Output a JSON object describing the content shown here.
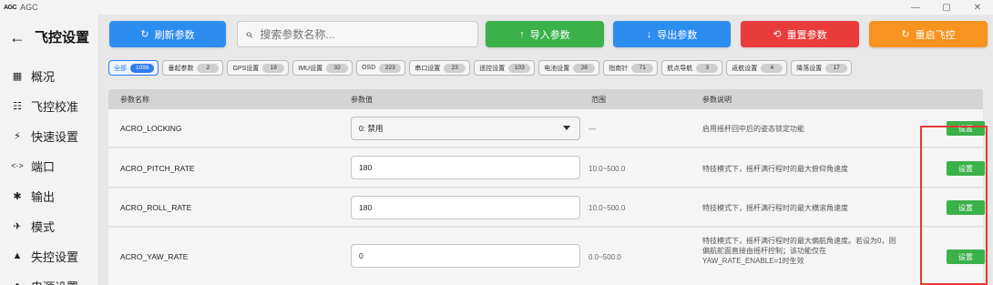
{
  "window": {
    "logo": "AGC",
    "title": "AGC",
    "controls": {
      "minimize": "—",
      "maximize": "▢",
      "close": "✕"
    }
  },
  "sidebar": {
    "back_icon": "←",
    "title": "飞控设置",
    "items": [
      {
        "icon": "grid-icon",
        "glyph": "▦",
        "label": "概况"
      },
      {
        "icon": "sliders-icon",
        "glyph": "☷",
        "label": "飞控校准"
      },
      {
        "icon": "lightning-icon",
        "glyph": "⚡",
        "label": "快速设置"
      },
      {
        "icon": "ports-icon",
        "glyph": "<·>",
        "label": "端口"
      },
      {
        "icon": "gear-icon",
        "glyph": "✱",
        "label": "输出"
      },
      {
        "icon": "airplane-icon",
        "glyph": "✈",
        "label": "模式"
      },
      {
        "icon": "warning-icon",
        "glyph": "▲",
        "label": "失控设置"
      },
      {
        "icon": "settings-icon",
        "glyph": "◆",
        "label": "电源设置"
      }
    ]
  },
  "toolbar": {
    "refresh": {
      "label": "刷新参数",
      "icon": "refresh-icon",
      "glyph": "↻",
      "color": "#2d8cf0"
    },
    "search": {
      "placeholder": "搜索参数名称...",
      "icon": "search-icon",
      "glyph": "⌕"
    },
    "import": {
      "label": "导入参数",
      "icon": "upload-icon",
      "glyph": "↑",
      "color": "#3bb14a"
    },
    "export": {
      "label": "导出参数",
      "icon": "download-icon",
      "glyph": "↓",
      "color": "#2d8cf0"
    },
    "reset": {
      "label": "重置参数",
      "icon": "reset-icon",
      "glyph": "⟲",
      "color": "#ea3b3b"
    },
    "reboot": {
      "label": "重启飞控",
      "icon": "reboot-icon",
      "glyph": "↻",
      "color": "#f7931e"
    }
  },
  "categories": [
    {
      "label": "全部",
      "count": "1099",
      "active": true
    },
    {
      "label": "垂起参数",
      "count": "2"
    },
    {
      "label": "GPS设置",
      "count": "18"
    },
    {
      "label": "IMU设置",
      "count": "32"
    },
    {
      "label": "OSD",
      "count": "223"
    },
    {
      "label": "串口设置",
      "count": "23"
    },
    {
      "label": "遥控设置",
      "count": "103"
    },
    {
      "label": "电池设置",
      "count": "28"
    },
    {
      "label": "指南针",
      "count": "71"
    },
    {
      "label": "航点导航",
      "count": "3"
    },
    {
      "label": "返航设置",
      "count": "4"
    },
    {
      "label": "降落设置",
      "count": "17"
    }
  ],
  "table": {
    "headers": {
      "name": "参数名称",
      "value": "参数值",
      "range": "范围",
      "desc": "参数说明"
    },
    "set_label": "设置",
    "rows": [
      {
        "name": "ACRO_LOCKING",
        "value": "0: 禁用",
        "type": "select",
        "range": "---",
        "desc": "启用摇杆回中后的姿态锁定功能"
      },
      {
        "name": "ACRO_PITCH_RATE",
        "value": "180",
        "type": "input",
        "range": "10.0~500.0",
        "desc": "特技模式下，摇杆满行程时的最大俯仰角速度"
      },
      {
        "name": "ACRO_ROLL_RATE",
        "value": "180",
        "type": "input",
        "range": "10.0~500.0",
        "desc": "特技模式下，摇杆满行程时的最大横滚角速度"
      },
      {
        "name": "ACRO_YAW_RATE",
        "value": "0",
        "type": "input",
        "range": "0.0~500.0",
        "desc_lines": [
          "特技模式下，摇杆满行程时的最大偏航角速度。若设为0，则",
          "偏航舵面直接由摇杆控制；该功能仅在",
          "YAW_RATE_ENABLE=1时生效"
        ]
      }
    ]
  },
  "highlight": {
    "color": "#e53935",
    "target": "设置 buttons column"
  }
}
